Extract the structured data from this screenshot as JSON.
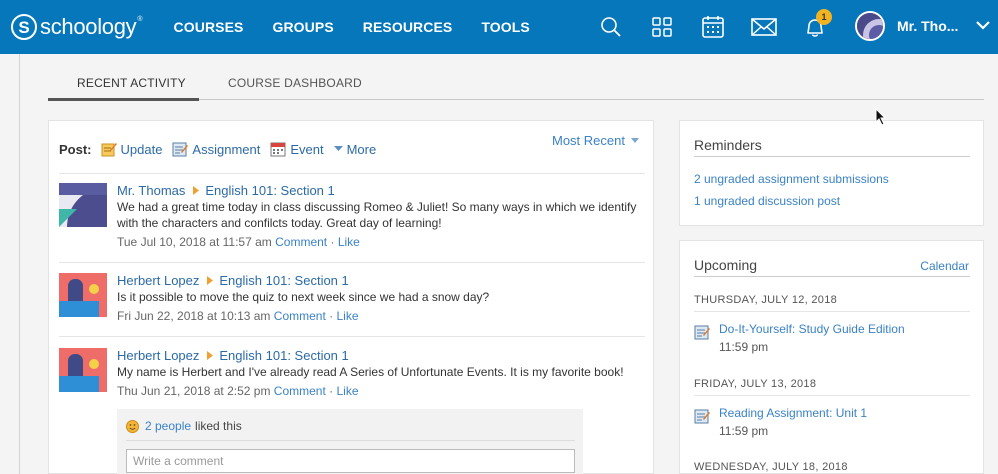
{
  "nav": {
    "logo_letter": "S",
    "logo_text": "schoology",
    "logo_tm": "®",
    "links": [
      "COURSES",
      "GROUPS",
      "RESOURCES",
      "TOOLS"
    ],
    "notification_count": "1",
    "user_name": "Mr. Tho..."
  },
  "tabs": {
    "recent": "RECENT ACTIVITY",
    "course_dashboard": "COURSE DASHBOARD"
  },
  "postbar": {
    "label": "Post:",
    "update": "Update",
    "assignment": "Assignment",
    "event": "Event",
    "more": "More",
    "sort": "Most Recent"
  },
  "posts": [
    {
      "author": "Mr. Thomas",
      "course": "English 101: Section 1",
      "text": "We had a great time today in class discussing Romeo & Juliet! So many ways in which we identify with the characters and confilcts today. Great day of learning!",
      "date": "Tue Jul 10, 2018 at 11:57 am",
      "comment": "Comment",
      "sep": "·",
      "like": "Like"
    },
    {
      "author": "Herbert Lopez",
      "course": "English 101: Section 1",
      "text": "Is it possible to move the quiz to next week since we had a snow day?",
      "date": "Fri Jun 22, 2018 at 10:13 am",
      "comment": "Comment",
      "sep": "·",
      "like": "Like"
    },
    {
      "author": "Herbert Lopez",
      "course": "English 101: Section 1",
      "text": "My name is Herbert and I've already read A Series of Unfortunate Events. It is my favorite book!",
      "date": "Thu Jun 21, 2018 at 2:52 pm",
      "comment": "Comment",
      "sep": "·",
      "like": "Like"
    }
  ],
  "likes": {
    "people": "2 people",
    "suffix": "liked this",
    "comment_placeholder": "Write a comment"
  },
  "reminders": {
    "title": "Reminders",
    "items": [
      "2 ungraded assignment submissions",
      "1 ungraded discussion post"
    ]
  },
  "upcoming": {
    "title": "Upcoming",
    "calendar": "Calendar",
    "days": [
      {
        "date": "THURSDAY, JULY 12, 2018",
        "event": "Do-It-Yourself: Study Guide Edition",
        "time": "11:59 pm"
      },
      {
        "date": "FRIDAY, JULY 13, 2018",
        "event": "Reading Assignment: Unit 1",
        "time": "11:59 pm"
      },
      {
        "date": "WEDNESDAY, JULY 18, 2018"
      }
    ]
  },
  "colors": {
    "nav_bg": "#0677ba",
    "link": "#3b82c4",
    "badge": "#f2b320",
    "arrow": "#f0a030"
  }
}
